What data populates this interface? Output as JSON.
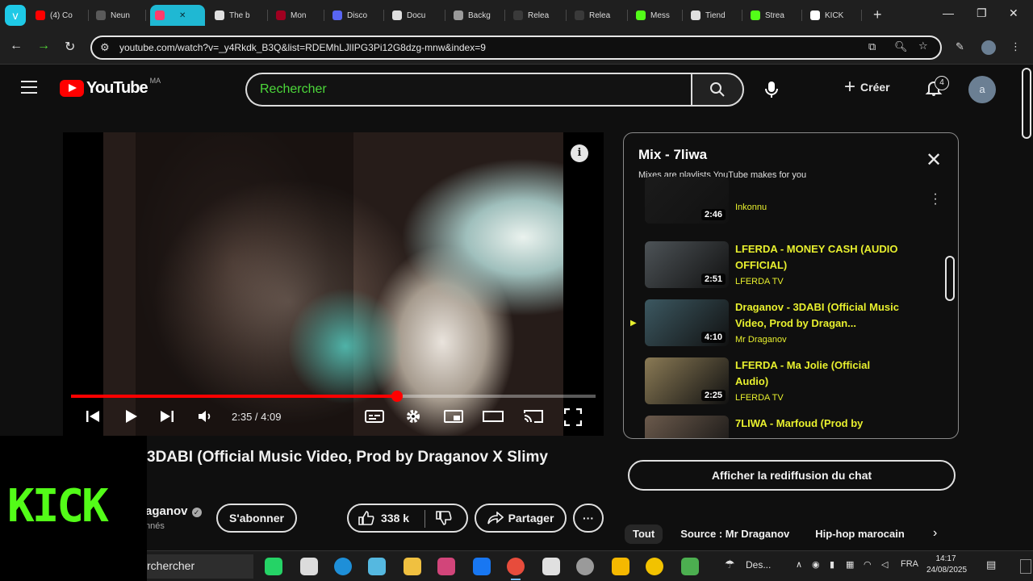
{
  "browser": {
    "ext_icon": "v",
    "tabs": [
      {
        "label": "(4) Co",
        "fav": "#ff0000"
      },
      {
        "label": "Neun",
        "fav": "#5a5a5a"
      },
      {
        "label": "",
        "fav": "#ff3b6b",
        "active": true
      },
      {
        "label": "The b",
        "fav": "#e0e0e0"
      },
      {
        "label": "Mon",
        "fav": "#a00020"
      },
      {
        "label": "Disco",
        "fav": "#5865f2"
      },
      {
        "label": "Docu",
        "fav": "#e0e0e0"
      },
      {
        "label": "Backg",
        "fav": "#9a9a9a"
      },
      {
        "label": "Relea",
        "fav": "#3a3a3a"
      },
      {
        "label": "Relea",
        "fav": "#3a3a3a"
      },
      {
        "label": "Mess",
        "fav": "#53fc18"
      },
      {
        "label": "Tiend",
        "fav": "#e0e0e0"
      },
      {
        "label": "Strea",
        "fav": "#53fc18"
      },
      {
        "label": "KICK",
        "fav": "#ffffff"
      }
    ],
    "new_tab": "+",
    "url": "youtube.com/watch?v=_y4Rkdk_B3Q&list=RDEMhLJlIPG3Pi12G8dzg-mnw&index=9"
  },
  "youtube": {
    "logo_text": "YouTube",
    "country_code": "MA",
    "search_placeholder": "Rechercher",
    "create_label": "Créer",
    "notif_count": "4",
    "avatar_letter": "a"
  },
  "player": {
    "time": "2:35 / 4:09",
    "progress": 0.622
  },
  "playlist": {
    "title": "Mix - 7liwa",
    "subtitle": "Mixes are playlists YouTube makes for you",
    "items": [
      {
        "title": "",
        "channel": "Inkonnu",
        "duration": "2:46",
        "thumb": "#1b1b1b",
        "now": false
      },
      {
        "title": "LFERDA - MONEY CASH (AUDIO OFFICIAL)",
        "channel": "LFERDA TV",
        "duration": "2:51",
        "thumb": "#4d5357",
        "now": false
      },
      {
        "title": "Draganov - 3DABI (Official Music Video, Prod by Dragan...",
        "channel": "Mr Draganov",
        "duration": "4:10",
        "thumb": "#3c5861",
        "now": true
      },
      {
        "title": "LFERDA - Ma Jolie (Official Audio)",
        "channel": "LFERDA TV",
        "duration": "2:25",
        "thumb": "#8a7a55",
        "now": false
      },
      {
        "title": "7LIWA - Marfoud (Prod by",
        "channel": "",
        "duration": "",
        "thumb": "#6b5a4c",
        "now": false
      }
    ]
  },
  "video": {
    "title": "3DABI (Official Music Video, Prod by Draganov X Slimy",
    "channel": "aganov",
    "subs": "nnés",
    "subscribe_label": "S'abonner",
    "likes": "338 k",
    "share_label": "Partager",
    "more_label": "···"
  },
  "chat_button": "Afficher la rediffusion du chat",
  "chips": [
    "Tout",
    "Source : Mr Draganov",
    "Hip-hop marocain"
  ],
  "kick_logo": "KICK",
  "taskbar": {
    "search_text": "rchercher",
    "weather_label": "Des...",
    "lang": "FRA",
    "time": "14:17",
    "date": "24/08/2025"
  }
}
